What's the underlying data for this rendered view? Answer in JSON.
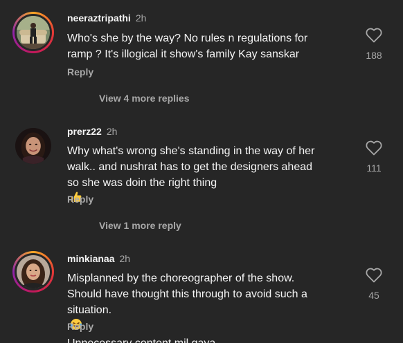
{
  "comments": [
    {
      "username": "neeraztripathi",
      "time": "2h",
      "lines": [
        "Who's she by the way? No rules n regulations for",
        "ramp ? It's illogical it show's family Kay sanskar"
      ],
      "reply_label": "Reply",
      "likes": "188",
      "avatar_icon": "person-on-sofa-avatar",
      "has_story_ring": true
    },
    {
      "username": "prerz22",
      "time": "2h",
      "lines": [
        "Why what's wrong she's standing in the way of her",
        "walk.. and nushrat has to get the designers ahead",
        "so she was doin the right thing"
      ],
      "emoji": "thumbs-up-emoji",
      "reply_label": "Reply",
      "likes": "111",
      "avatar_icon": "woman-portrait-avatar",
      "has_story_ring": false
    },
    {
      "username": "minkianaa",
      "time": "2h",
      "lines": [
        "Misplanned by the choreographer of the show.",
        "Should have thought this through to avoid such a",
        "situation.",
        "Unnecessary content mil gaya"
      ],
      "emoji": "laughing-tears-emoji",
      "reply_label": "Reply",
      "likes": "45",
      "avatar_icon": "woman-selfie-avatar",
      "has_story_ring": true
    }
  ],
  "more_replies": [
    {
      "label": "View 4 more replies"
    },
    {
      "label": "View 1 more reply"
    }
  ],
  "colors": {
    "background": "#262626",
    "primary_text": "#f5f5f5",
    "secondary_text": "#a8a8a8"
  }
}
